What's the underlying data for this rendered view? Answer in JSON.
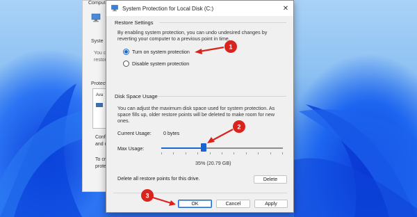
{
  "dialog": {
    "title": "System Protection for Local Disk (C:)",
    "close_glyph": "✕",
    "restore_settings": {
      "heading": "Restore Settings",
      "description": "By enabling system protection, you can undo undesired changes by reverting your computer to a previous point in time.",
      "options": [
        {
          "label": "Turn on system protection",
          "selected": true
        },
        {
          "label": "Disable system protection",
          "selected": false
        }
      ]
    },
    "disk_space": {
      "heading": "Disk Space Usage",
      "description": "You can adjust the maximum disk space used for system protection. As space fills up, older restore points will be deleted to make room for new ones.",
      "current_usage_label": "Current Usage:",
      "current_usage_value": "0 bytes",
      "max_usage_label": "Max Usage:",
      "max_usage_fraction": 0.35,
      "max_usage_text": "35% (20.79 GB)",
      "delete_text": "Delete all restore points for this drive.",
      "delete_button": "Delete"
    },
    "buttons": {
      "ok": "OK",
      "cancel": "Cancel",
      "apply": "Apply"
    }
  },
  "background_window": {
    "fragments": [
      "Compute",
      "Syste",
      "You c",
      "restor",
      "Protecti",
      "Ava",
      "Conf",
      "and d",
      "To cr",
      "prote"
    ]
  },
  "annotations": {
    "badge_color": "#d9231c",
    "badges": [
      "1",
      "2",
      "3"
    ]
  },
  "colors": {
    "accent": "#1a66d0",
    "annotation_red": "#d9231c"
  }
}
